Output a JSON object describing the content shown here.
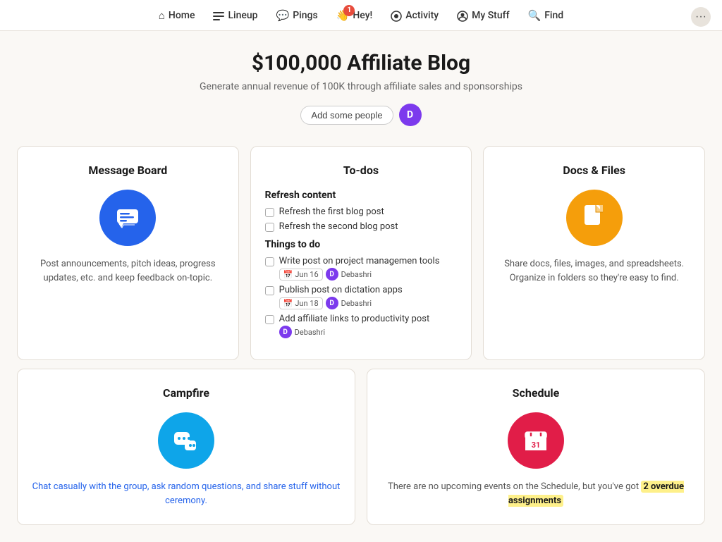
{
  "nav": {
    "items": [
      {
        "label": "Home",
        "icon": "⌂",
        "name": "home"
      },
      {
        "label": "Lineup",
        "icon": "≡",
        "name": "lineup"
      },
      {
        "label": "Pings",
        "icon": "💬",
        "name": "pings"
      },
      {
        "label": "Hey!",
        "icon": "👋",
        "name": "hey",
        "badge": "1"
      },
      {
        "label": "Activity",
        "icon": "●",
        "name": "activity"
      },
      {
        "label": "My Stuff",
        "icon": "☺",
        "name": "my-stuff"
      },
      {
        "label": "Find",
        "icon": "🔍",
        "name": "find"
      }
    ],
    "more_label": "···"
  },
  "header": {
    "title": "$100,000 Affiliate Blog",
    "subtitle": "Generate annual revenue of 100K through affiliate sales and sponsorships",
    "add_people_label": "Add some people",
    "avatar_initials": "D"
  },
  "message_board": {
    "title": "Message Board",
    "icon": "💬",
    "description": "Post announcements, pitch ideas, progress updates, etc. and keep feedback on-topic."
  },
  "todos": {
    "title": "To-dos",
    "sections": [
      {
        "title": "Refresh content",
        "items": [
          {
            "label": "Refresh the first blog post",
            "checked": false
          },
          {
            "label": "Refresh the second blog post",
            "checked": false
          }
        ]
      },
      {
        "title": "Things to do",
        "items": [
          {
            "label": "Write post on project managemen tools",
            "checked": false,
            "date": "Jun 16",
            "assignee": "Debashri"
          },
          {
            "label": "Publish post on dictation apps",
            "checked": false,
            "date": "Jun 18",
            "assignee": "Debashri"
          },
          {
            "label": "Add affiliate links to productivity post",
            "checked": false,
            "assignee": "Debashri"
          }
        ]
      }
    ]
  },
  "docs_files": {
    "title": "Docs & Files",
    "icon": "📄",
    "description": "Share docs, files, images, and spreadsheets. Organize in folders so they're easy to find."
  },
  "campfire": {
    "title": "Campfire",
    "icon": "💬",
    "description": "Chat casually with the group, ask random questions, and share stuff without ceremony."
  },
  "schedule": {
    "title": "Schedule",
    "icon": "📅",
    "description_prefix": "There are no upcoming events on the Schedule, but you've got",
    "overdue_label": "2 overdue assignments",
    "description_suffix": ""
  }
}
